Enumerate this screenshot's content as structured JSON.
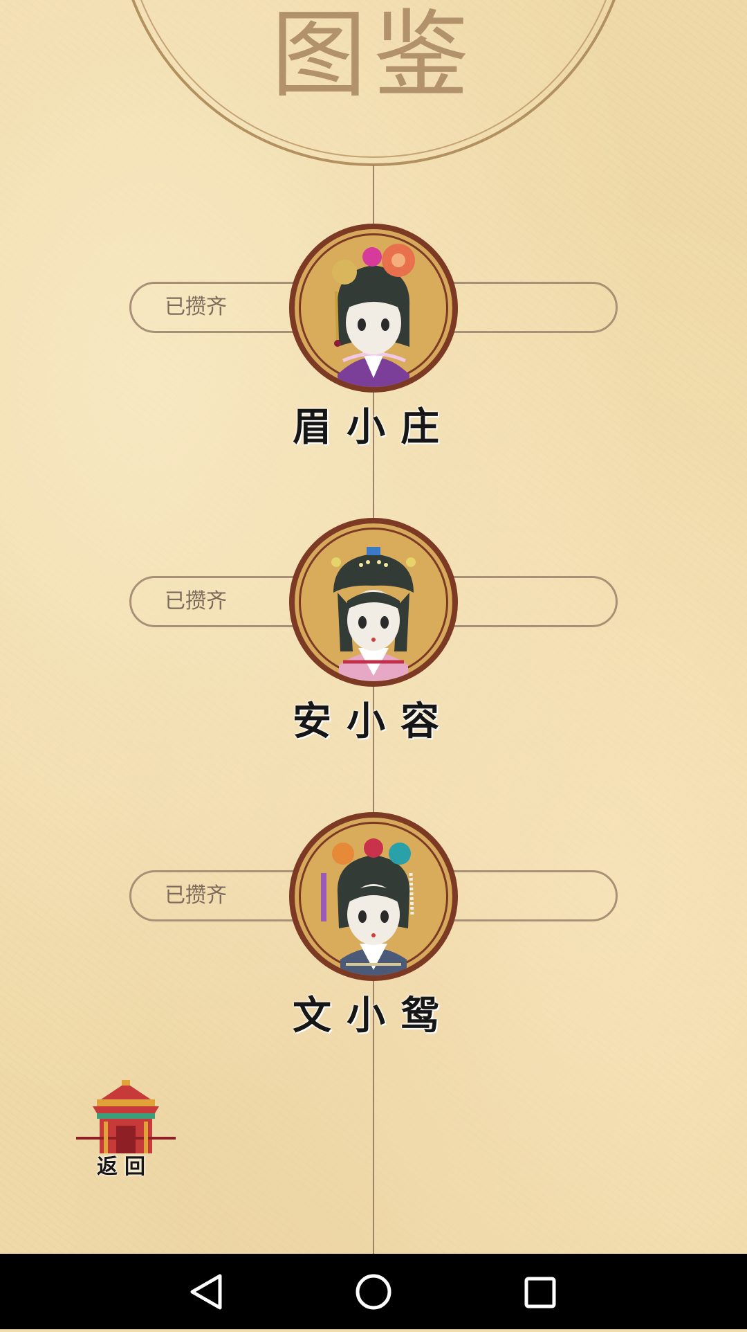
{
  "header": {
    "title": "图鉴"
  },
  "characters": [
    {
      "name": "眉小庄",
      "status": "已攒齐"
    },
    {
      "name": "安小容",
      "status": "已攒齐"
    },
    {
      "name": "文小鸳",
      "status": "已攒齐"
    }
  ],
  "back_button": {
    "label": "返回"
  },
  "nav_bar": {
    "back_icon": "triangle-back-icon",
    "home_icon": "circle-home-icon",
    "recents_icon": "square-recents-icon"
  },
  "colors": {
    "paper": "#efd9a8",
    "medal_ring": "#7c3a24",
    "medal_fill": "#d8ac5a",
    "pill_stroke": "#a89076",
    "title_color": "#b1926a"
  }
}
